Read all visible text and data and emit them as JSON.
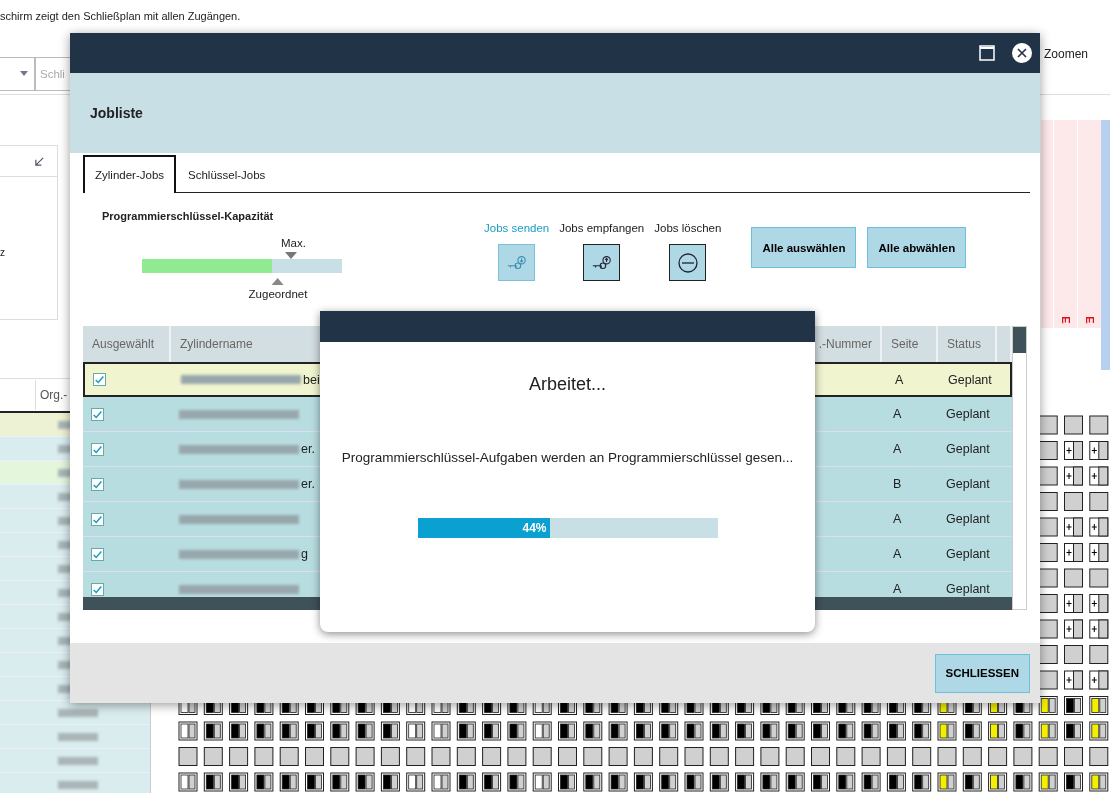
{
  "background": {
    "intro_text": "schirm zeigt den Schließplan mit allen Zugängen.",
    "search_field": {
      "placeholder": "Schli"
    },
    "zoom_label": "Zoomen",
    "panel_text": "z",
    "column_header": "Org.-",
    "column_markers": [
      "E",
      "E"
    ]
  },
  "dialog": {
    "title": "Jobliste",
    "tabs": [
      {
        "label": "Zylinder-Jobs",
        "selected": true
      },
      {
        "label": "Schlüssel-Jobs",
        "selected": false
      }
    ],
    "capacity": {
      "title": "Programmierschlüssel-Kapazität",
      "level": 0.65,
      "max_label": "Max.",
      "assigned_label": "Zugeordnet"
    },
    "actions": [
      {
        "label": "Jobs senden",
        "kind": "send",
        "selected": true
      },
      {
        "label": "Jobs empfangen",
        "kind": "receive",
        "selected": false
      },
      {
        "label": "Jobs löschen",
        "kind": "delete",
        "selected": false
      }
    ],
    "buttons": [
      "Alle auswählen",
      "Alle abwählen"
    ],
    "table": {
      "columns": [
        "Ausgewählt",
        "Zylindername",
        ".-Nummer",
        "Seite",
        "Status"
      ],
      "rows": [
        {
          "checked": true,
          "selected": true,
          "name_tail": "bei",
          "seite": "A",
          "status": "Geplant"
        },
        {
          "checked": true,
          "selected": false,
          "seite": "A",
          "status": "Geplant"
        },
        {
          "checked": true,
          "selected": false,
          "name_tail": "er.",
          "seite": "A",
          "status": "Geplant"
        },
        {
          "checked": true,
          "selected": false,
          "name_tail": "er.",
          "seite": "B",
          "status": "Geplant"
        },
        {
          "checked": true,
          "selected": false,
          "seite": "A",
          "status": "Geplant"
        },
        {
          "checked": true,
          "selected": false,
          "name_tail": "g",
          "seite": "A",
          "status": "Geplant"
        },
        {
          "checked": true,
          "selected": false,
          "seite": "A",
          "status": "Geplant"
        }
      ]
    },
    "close_button": "SCHLIESSEN"
  },
  "progress": {
    "title": "Arbeitet...",
    "message": "Programmierschlüssel-Aufgaben werden an Programmierschlüssel gesen...",
    "level": 0.44,
    "reading": "44%"
  }
}
